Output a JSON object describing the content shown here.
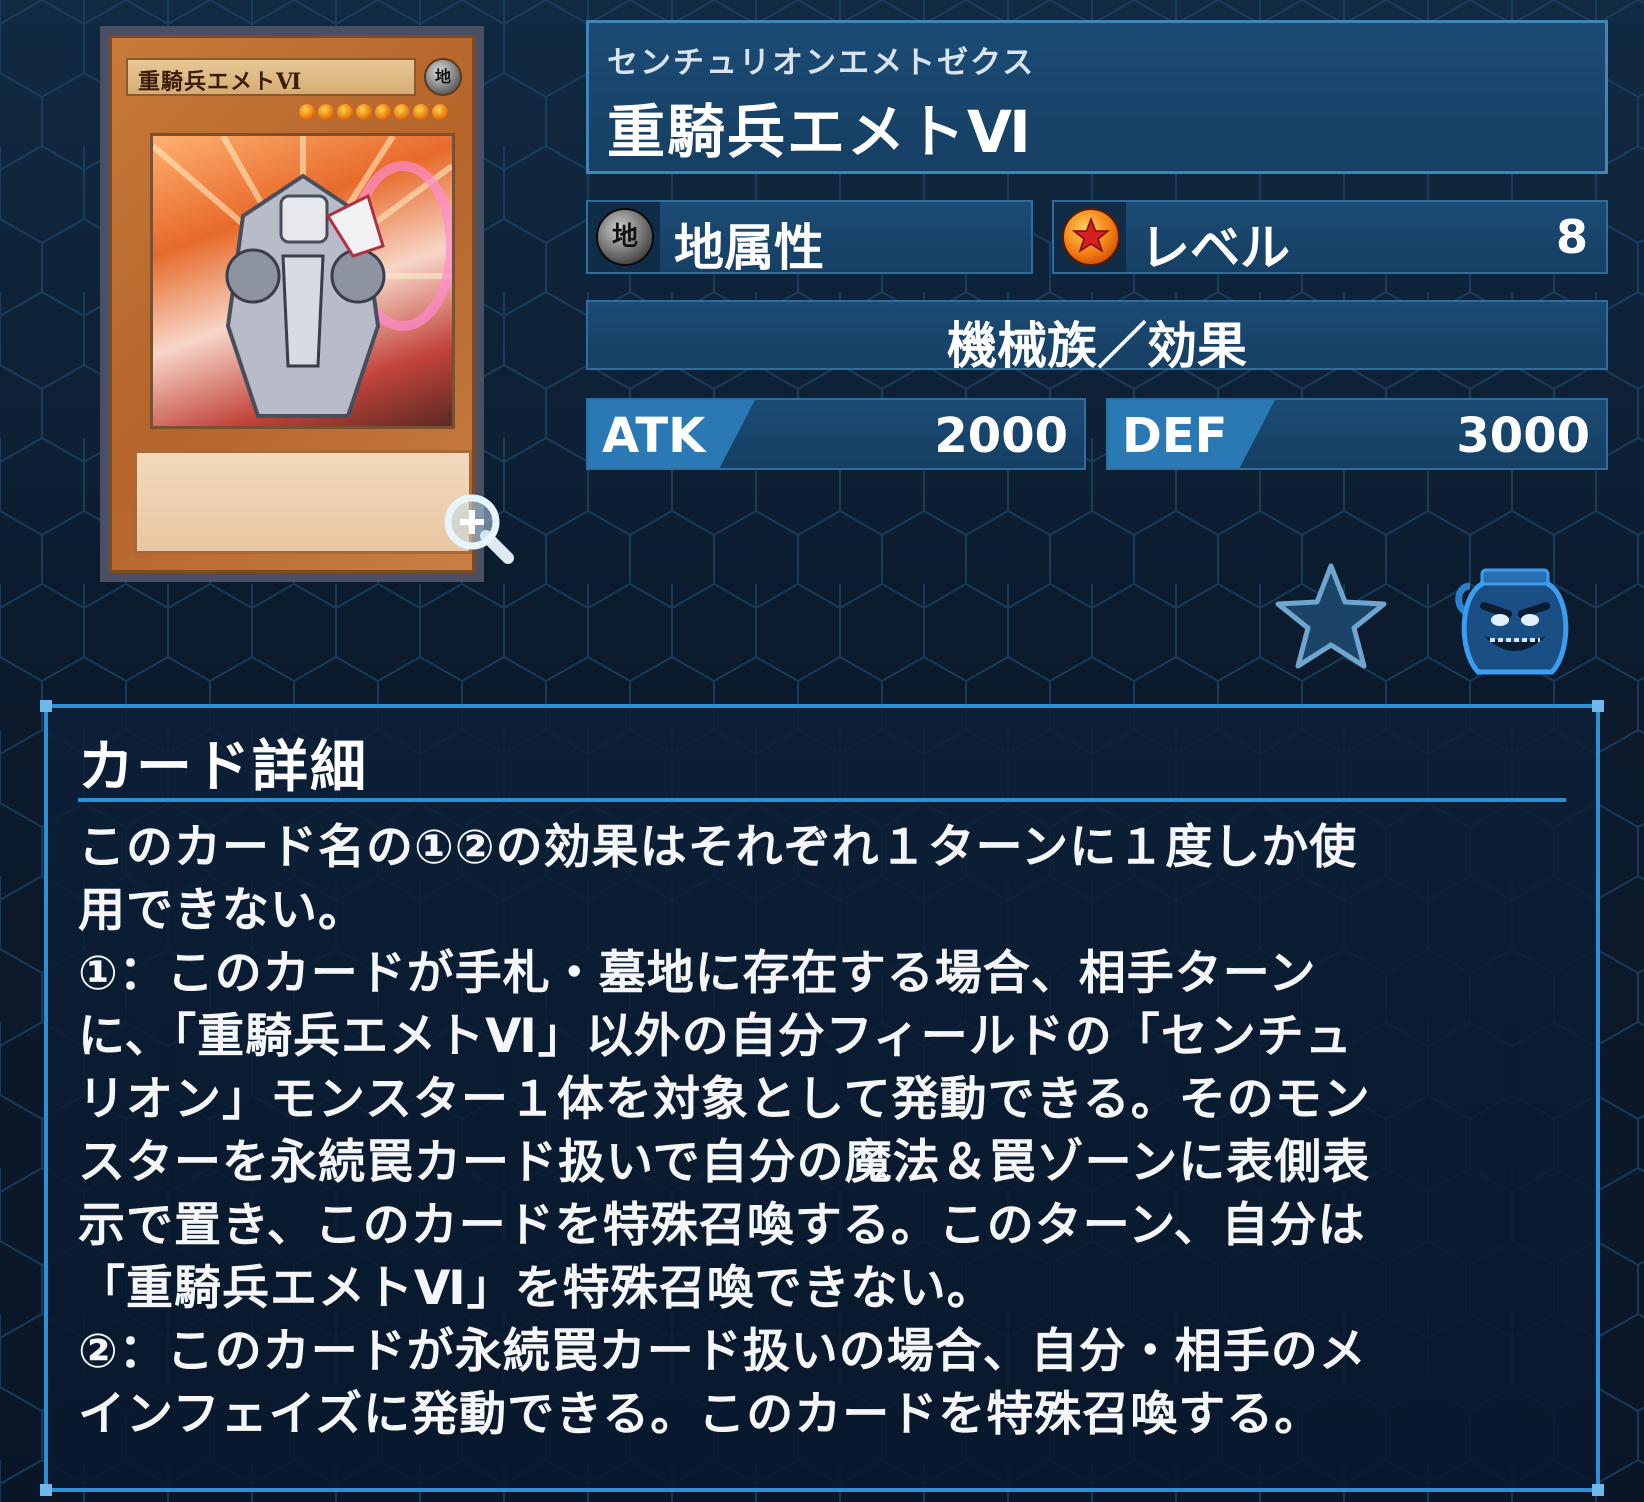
{
  "card": {
    "ruby": "センチュリオンエメトゼクス",
    "name": "重騎兵エメトⅥ",
    "image_name": "重騎兵エメトⅥ",
    "image_attribute_glyph": "地",
    "attribute": {
      "icon": "earth-attribute-icon",
      "glyph": "地",
      "label": "地属性"
    },
    "level": {
      "icon": "level-star-icon",
      "label": "レベル",
      "value": "8"
    },
    "type": "機械族／効果",
    "atk": {
      "label": "ATK",
      "value": "2000"
    },
    "def": {
      "label": "DEF",
      "value": "3000"
    }
  },
  "actions": {
    "zoom": "zoom-in-icon",
    "favorite": "favorite-star-icon",
    "pot": "pot-of-greed-icon"
  },
  "detail": {
    "title": "カード詳細",
    "text": "このカード名の①②の効果はそれぞれ１ターンに１度しか使\n用できない。\n①：このカードが手札・墓地に存在する場合、相手ターン\nに、「重騎兵エメトⅥ」以外の自分フィールドの「センチュ\nリオン」モンスター１体を対象として発動できる。そのモン\nスターを永続罠カード扱いで自分の魔法＆罠ゾーンに表側表\n示で置き、このカードを特殊召喚する。このターン、自分は\n「重騎兵エメトⅥ」を特殊召喚できない。\n②：このカードが永続罠カード扱いの場合、自分・相手のメ\nインフェイズに発動できる。このカードを特殊召喚する。"
  },
  "colors": {
    "background": "#0c1a2c",
    "panel": "#1b4b74",
    "accent": "#2f8fd4",
    "card_frame": "#c77a3a"
  }
}
